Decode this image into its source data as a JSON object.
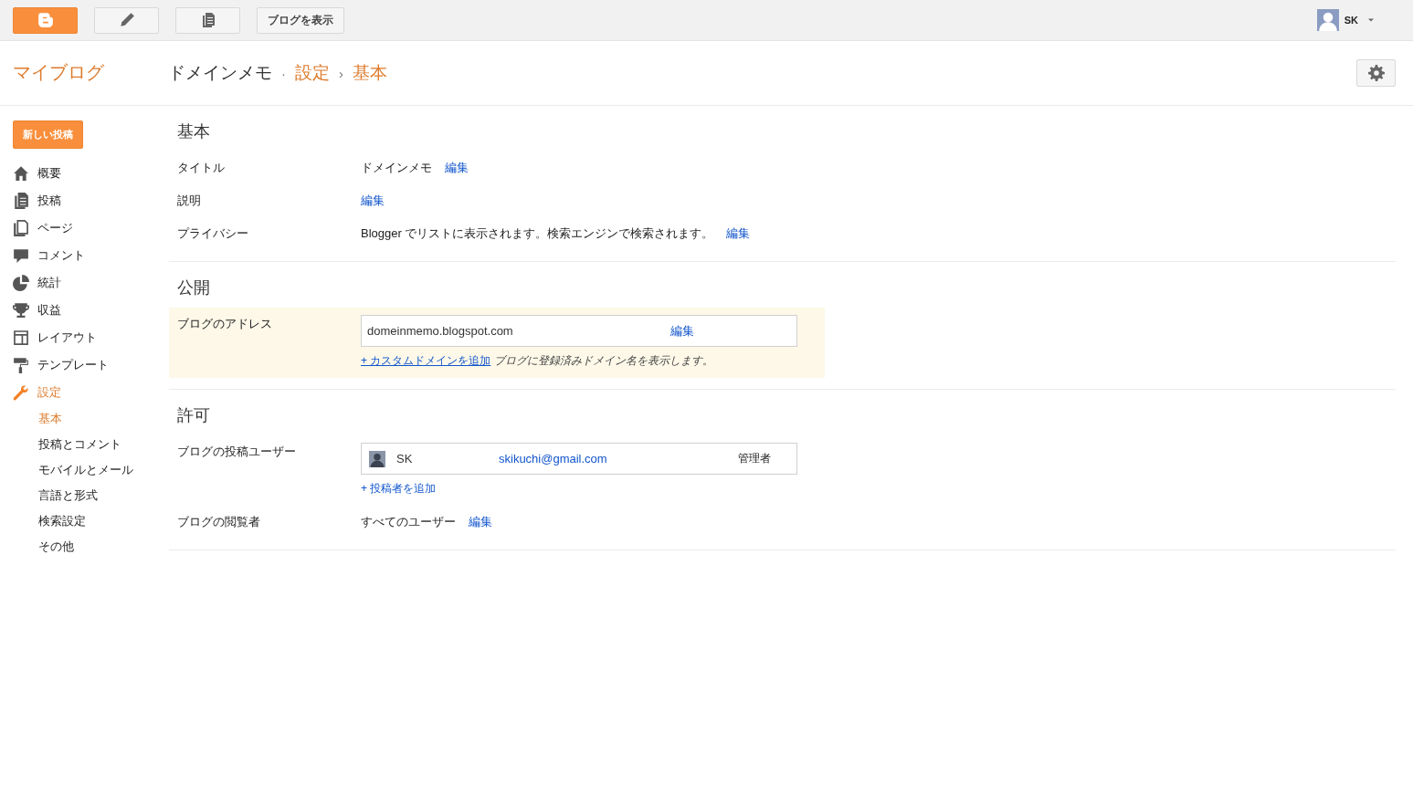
{
  "topbar": {
    "buttons": [
      {
        "kind": "logo"
      },
      {
        "kind": "new-post"
      },
      {
        "kind": "posts"
      },
      {
        "kind": "text",
        "label": "ブログを表示"
      }
    ],
    "user": {
      "name": "SK"
    }
  },
  "header": {
    "my_blogs": "マイブログ",
    "breadcrumb": [
      "ドメインメモ",
      "設定",
      "基本"
    ],
    "separators": [
      "·",
      "›"
    ]
  },
  "sidebar": {
    "new_post": "新しい投稿",
    "items": [
      {
        "label": "概要",
        "kind": "overview",
        "selected": false
      },
      {
        "label": "投稿",
        "kind": "posts",
        "selected": false
      },
      {
        "label": "ページ",
        "kind": "pages",
        "selected": false
      },
      {
        "label": "コメント",
        "kind": "comments",
        "selected": false
      },
      {
        "label": "統計",
        "kind": "stats",
        "selected": false
      },
      {
        "label": "収益",
        "kind": "earnings",
        "selected": false
      },
      {
        "label": "レイアウト",
        "kind": "layout",
        "selected": false
      },
      {
        "label": "テンプレート",
        "kind": "template",
        "selected": false
      },
      {
        "label": "設定",
        "kind": "settings",
        "selected": true,
        "children": [
          {
            "label": "基本",
            "selected": true
          },
          {
            "label": "投稿とコメント",
            "selected": false
          },
          {
            "label": "モバイルとメール",
            "selected": false
          },
          {
            "label": "言語と形式",
            "selected": false
          },
          {
            "label": "検索設定",
            "selected": false
          },
          {
            "label": "その他",
            "selected": false
          }
        ]
      }
    ]
  },
  "sections": [
    {
      "title": "基本",
      "rows": [
        {
          "kind": "text",
          "label": "タイトル",
          "value": "ドメインメモ",
          "link": "編集"
        },
        {
          "kind": "text",
          "label": "説明",
          "link": "編集"
        },
        {
          "kind": "text",
          "label": "プライバシー",
          "value": "Blogger でリストに表示されます。検索エンジンで検索されます。",
          "link": "編集"
        }
      ]
    },
    {
      "title": "公開",
      "rows": [
        {
          "kind": "address",
          "label": "ブログのアドレス",
          "highlighted": true,
          "value": "domeinmemo.blogspot.com",
          "link": "編集",
          "add_link": "+ カスタムドメインを追加",
          "note": "ブログに登録済みドメイン名を表示します。"
        }
      ]
    },
    {
      "title": "許可",
      "rows": [
        {
          "kind": "users",
          "label": "ブログの投稿ユーザー",
          "users": [
            {
              "name": "SK",
              "email": "skikuchi@gmail.com",
              "role": "管理者"
            }
          ],
          "add_link": "+ 投稿者を追加"
        },
        {
          "kind": "text",
          "label": "ブログの閲覧者",
          "value": "すべてのユーザー",
          "link": "編集"
        }
      ]
    }
  ]
}
